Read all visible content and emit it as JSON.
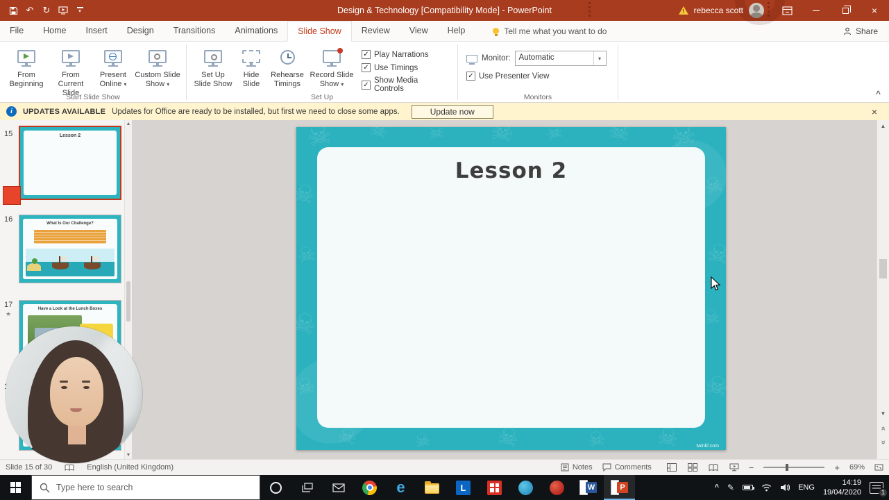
{
  "icons": {
    "check": "✓",
    "dropdown": "▾",
    "close": "×",
    "star": "★",
    "skull": "☠",
    "scroll_up": "▲",
    "scroll_down": "▼",
    "double_prev": "«",
    "double_next": "»",
    "undo": "↶",
    "redo": "↻",
    "collapse": "^",
    "tray_chevron": "^",
    "warning": "!",
    "info": "i",
    "zoom_out": "−",
    "zoom_in": "+",
    "pen": "✎",
    "edge_letter": "e",
    "letter_l": "L",
    "letter_w": "W",
    "letter_p": "P"
  },
  "title_bar": {
    "title": "Design & Technology [Compatibility Mode]  -  PowerPoint",
    "user_name": "rebecca scott"
  },
  "ribbon": {
    "tabs": [
      "File",
      "Home",
      "Insert",
      "Design",
      "Transitions",
      "Animations",
      "Slide Show",
      "Review",
      "View",
      "Help"
    ],
    "tell_me": "Tell me what you want to do",
    "share_label": "Share",
    "start_group": {
      "label": "Start Slide Show",
      "from_beginning": {
        "l1": "From",
        "l2": "Beginning"
      },
      "from_current": {
        "l1": "From",
        "l2": "Current Slide"
      },
      "present_online": {
        "l1": "Present",
        "l2": "Online"
      },
      "custom_show": {
        "l1": "Custom Slide",
        "l2": "Show"
      }
    },
    "setup_group": {
      "label": "Set Up",
      "setup_show": {
        "l1": "Set Up",
        "l2": "Slide Show"
      },
      "hide_slide": {
        "l1": "Hide",
        "l2": "Slide"
      },
      "rehearse": {
        "l1": "Rehearse",
        "l2": "Timings"
      },
      "record": {
        "l1": "Record Slide",
        "l2": "Show"
      },
      "play_narrations": "Play Narrations",
      "use_timings": "Use Timings",
      "show_media_controls": "Show Media Controls"
    },
    "monitors_group": {
      "label": "Monitors",
      "monitor_label": "Monitor:",
      "monitor_value": "Automatic",
      "use_presenter_view": "Use Presenter View"
    }
  },
  "notification_bar": {
    "badge": "UPDATES AVAILABLE",
    "message": "Updates for Office are ready to be installed, but first we need to close some apps.",
    "action_label": "Update now"
  },
  "thumbnails": [
    {
      "number": "15",
      "title": "Lesson 2"
    },
    {
      "number": "16",
      "title": "What Is Our Challenge?"
    },
    {
      "number": "17",
      "title": "Have a Look at the Lunch Boxes"
    },
    {
      "number": "18",
      "title": ""
    }
  ],
  "slide": {
    "title": "Lesson 2",
    "credit": "twinkl.com"
  },
  "status_bar": {
    "slide_info": "Slide 15 of 30",
    "language": "English (United Kingdom)",
    "notes_label": "Notes",
    "comments_label": "Comments",
    "zoom_level": "69%"
  },
  "taskbar": {
    "search_placeholder": "Type here to search",
    "language_code": "ENG",
    "time": "14:19",
    "date": "19/04/2020",
    "notification_count": "1"
  },
  "colors": {
    "titlebar_red": "#A83C1E",
    "tab_accent_red": "#C0391B",
    "slide_teal": "#2BB2BE",
    "selection_red": "#C4371C",
    "notification_yellow": "#FFF4CE"
  }
}
